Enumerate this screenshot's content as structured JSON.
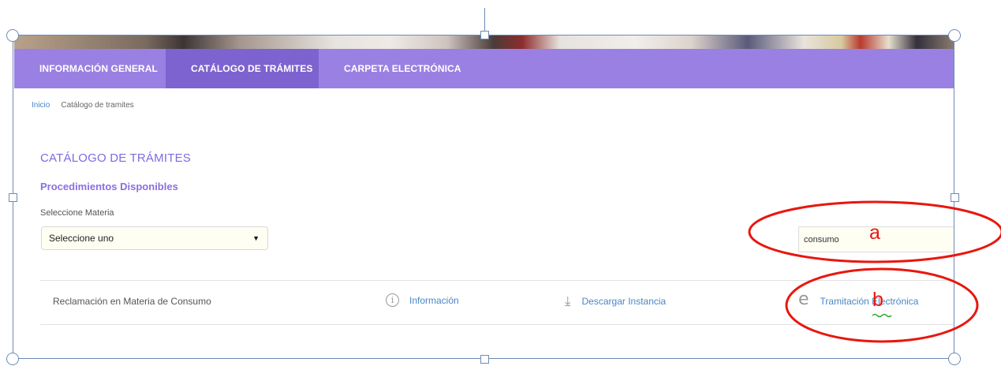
{
  "nav": {
    "tabs": [
      {
        "label": "INFORMACIÓN GENERAL"
      },
      {
        "label": "CATÁLOGO DE TRÁMITES"
      },
      {
        "label": "CARPETA ELECTRÓNICA"
      }
    ],
    "active_tab": "CATÁLOGO DE TRÁMITES"
  },
  "breadcrumb": {
    "home": "Inicio",
    "current": "Catálogo de tramites"
  },
  "page": {
    "title": "CATÁLOGO DE TRÁMITES",
    "subtitle": "Procedimientos Disponibles",
    "materia_label": "Seleccione Materia",
    "materia_selected": "Seleccione uno"
  },
  "search": {
    "value": "consumo"
  },
  "procedure": {
    "name": "Reclamación en Materia de Consumo",
    "info_label": "Información",
    "download_label": "Descargar Instancia",
    "tramitacion_label": "Tramitación Electrónica"
  },
  "annotations": {
    "a": "a",
    "b": "b"
  },
  "colors": {
    "nav": "#9a80e2",
    "nav_active": "#7d63cf",
    "accent_text": "#8b6fe0",
    "link": "#4a86c5",
    "annotation": "#e8170f"
  },
  "icons": {
    "info": "info-circle-icon",
    "download": "download-icon",
    "tramitacion": "e-icon",
    "select_arrow": "triangle-down-icon"
  }
}
